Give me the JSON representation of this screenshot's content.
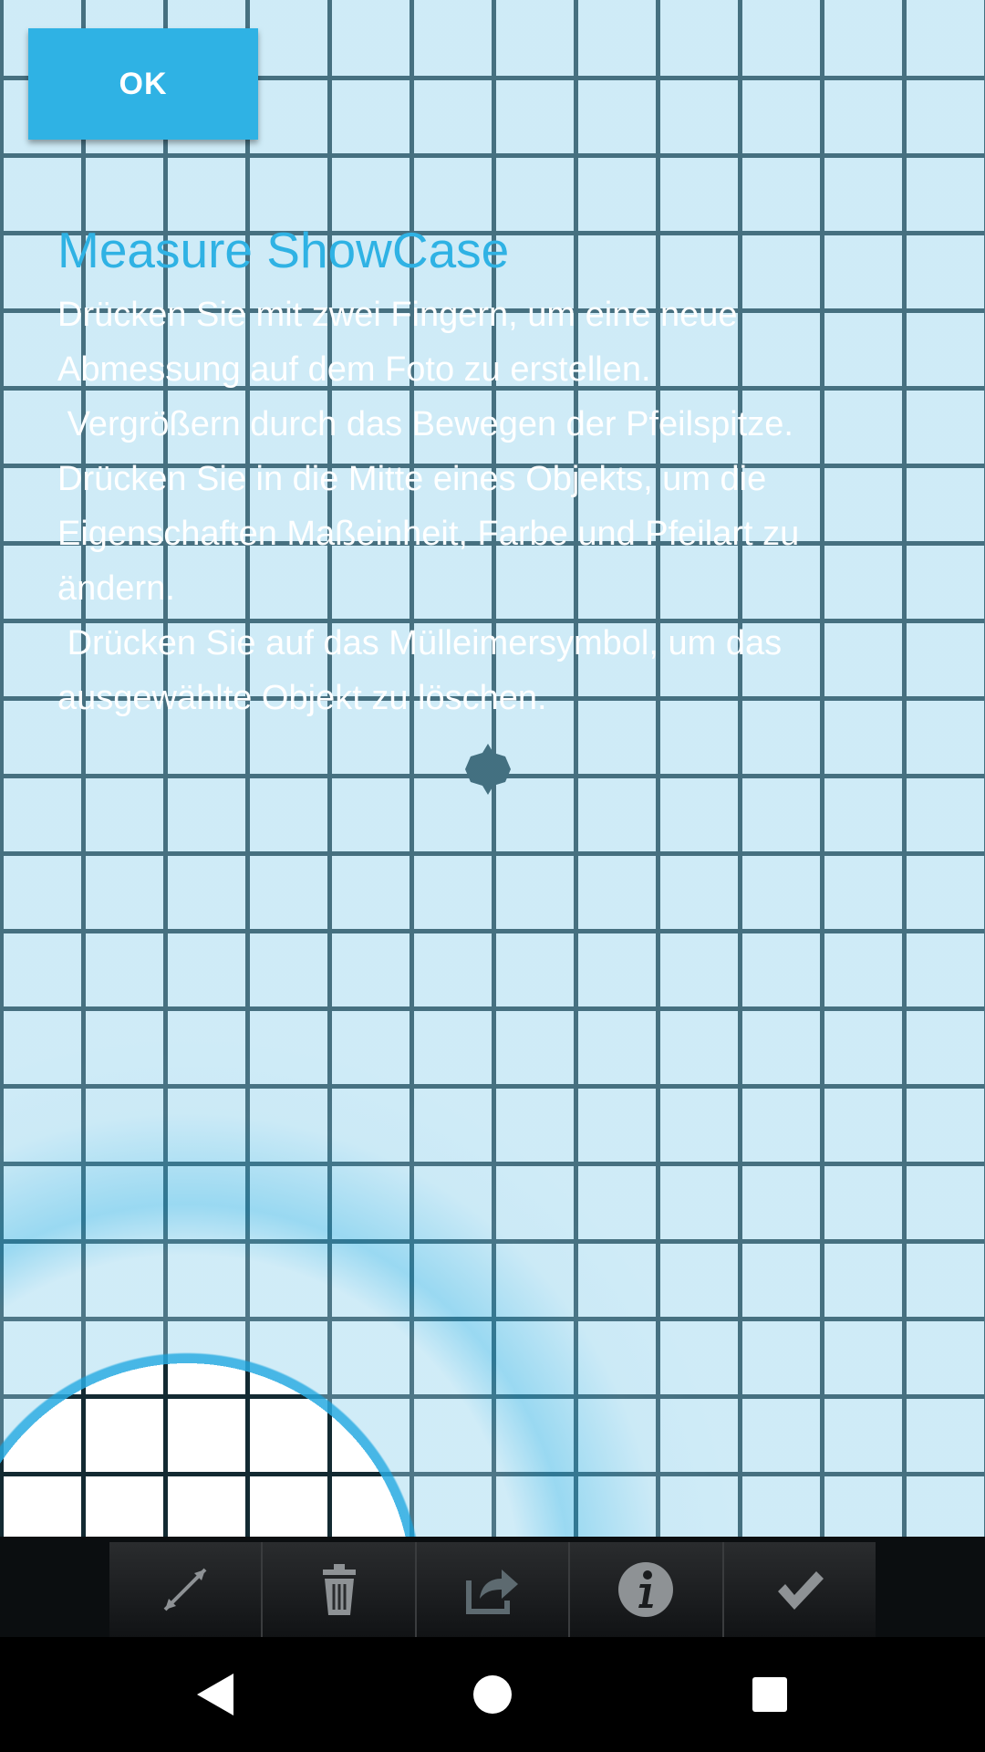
{
  "showcase": {
    "ok_label": "OK",
    "title": "Measure ShowCase",
    "text": "Drücken Sie mit zwei Fingern, um eine neue Abmessung auf dem Foto zu erstellen.\n Vergrößern durch das Bewegen der Pfeilspitze.\nDrücken Sie in die Mitte eines Objekts, um die Eigenschaften Maßeinheit, Farbe und Pfeilart zu ändern.\n Drücken Sie auf das Mülleimersymbol, um das ausgewählte Objekt zu löschen.",
    "accent_color": "#2fb2e4"
  },
  "toolbar": {
    "items": [
      {
        "icon": "measure-arrow-icon"
      },
      {
        "icon": "trash-icon"
      },
      {
        "icon": "share-icon"
      },
      {
        "icon": "info-icon"
      },
      {
        "icon": "checkmark-icon"
      }
    ]
  },
  "navbar": {
    "items": [
      {
        "icon": "back-icon"
      },
      {
        "icon": "home-icon"
      },
      {
        "icon": "recents-icon"
      }
    ]
  }
}
